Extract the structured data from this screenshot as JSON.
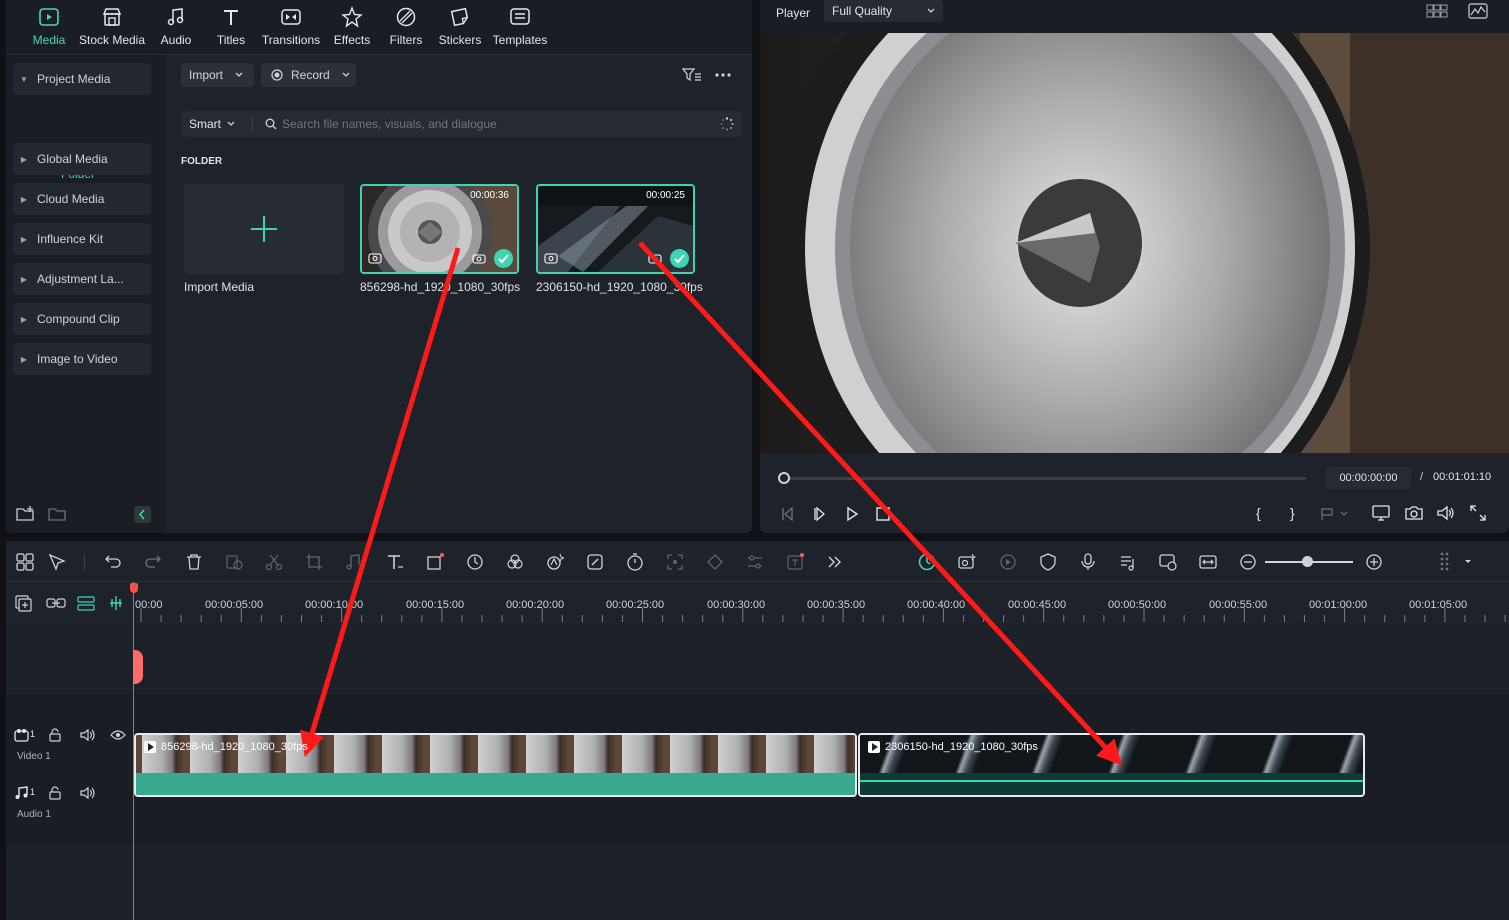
{
  "colors": {
    "accent": "#3fd4b0",
    "annotation_arrow": "#ff1a1a",
    "playhead": "#ff4d4d"
  },
  "tabs": [
    {
      "label": "Media",
      "icon": "media-icon",
      "active": true
    },
    {
      "label": "Stock Media",
      "icon": "stock-media-icon"
    },
    {
      "label": "Audio",
      "icon": "audio-note-icon"
    },
    {
      "label": "Titles",
      "icon": "titles-t-icon"
    },
    {
      "label": "Transitions",
      "icon": "transitions-icon"
    },
    {
      "label": "Effects",
      "icon": "effects-star-icon"
    },
    {
      "label": "Filters",
      "icon": "filters-icon"
    },
    {
      "label": "Stickers",
      "icon": "stickers-icon"
    },
    {
      "label": "Templates",
      "icon": "templates-icon"
    }
  ],
  "sidebar": {
    "project_media": "Project Media",
    "folder": "Folder",
    "items": [
      "Global Media",
      "Cloud Media",
      "Influence Kit",
      "Adjustment La...",
      "Compound Clip",
      "Image to Video"
    ]
  },
  "toolbar": {
    "import": "Import",
    "record": "Record"
  },
  "search": {
    "mode": "Smart",
    "placeholder": "Search file names, visuals, and dialogue"
  },
  "folder_heading": "FOLDER",
  "media": {
    "import_label": "Import Media",
    "items": [
      {
        "name": "856298-hd_1920_1080_30fps",
        "duration": "00:00:36",
        "selected": true
      },
      {
        "name": "2306150-hd_1920_1080_30fps",
        "duration": "00:00:25",
        "selected": true
      }
    ]
  },
  "player": {
    "label": "Player",
    "quality": "Full Quality",
    "current_time": "00:00:00:00",
    "separator": "/",
    "total_time": "00:01:01:10",
    "brace_open": "{",
    "brace_close": "}"
  },
  "ruler": {
    "labels": [
      "00:00",
      "00:00:05:00",
      "00:00:10:00",
      "00:00:15:00",
      "00:00:20:00",
      "00:00:25:00",
      "00:00:30:00",
      "00:00:35:00",
      "00:00:40:00",
      "00:00:45:00",
      "00:00:50:00",
      "00:00:55:00",
      "00:01:00:00",
      "00:01:05:00"
    ]
  },
  "tracks": {
    "video_label": "Video 1",
    "video_num": "1",
    "audio_label": "Audio 1",
    "audio_num": "1"
  },
  "clips": [
    {
      "name": "856298-hd_1920_1080_30fps"
    },
    {
      "name": "2306150-hd_1920_1080_30fps"
    }
  ]
}
